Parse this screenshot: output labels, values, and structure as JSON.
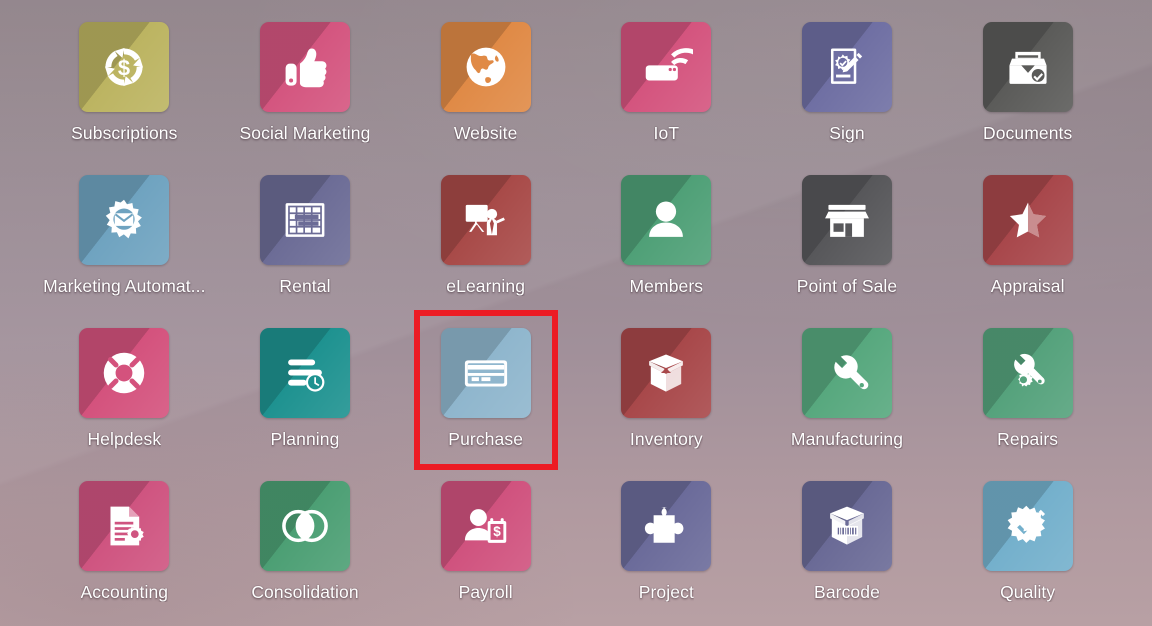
{
  "screen": {
    "title": "Odoo Apps Home Menu",
    "background_color": "#a08d93",
    "highlight_color": "#ec1c24",
    "label_color": "#ffffff"
  },
  "apps": [
    {
      "id": "subscriptions",
      "label": "Subscriptions",
      "icon": "refresh-dollar-icon",
      "tile_color": "#bcb461",
      "highlighted": false
    },
    {
      "id": "social-marketing",
      "label": "Social Marketing",
      "icon": "thumbs-up-icon",
      "tile_color": "#d4557f",
      "highlighted": false
    },
    {
      "id": "website",
      "label": "Website",
      "icon": "globe-icon",
      "tile_color": "#e08a46",
      "highlighted": false
    },
    {
      "id": "iot",
      "label": "IoT",
      "icon": "wifi-router-icon",
      "tile_color": "#d4547e",
      "highlighted": false
    },
    {
      "id": "sign",
      "label": "Sign",
      "icon": "document-pencil-icon",
      "tile_color": "#6f6fa3",
      "highlighted": false
    },
    {
      "id": "documents",
      "label": "Documents",
      "icon": "file-tray-check-icon",
      "tile_color": "#5b5b59",
      "highlighted": false
    },
    {
      "id": "marketing-automation",
      "label": "Marketing Automat...",
      "icon": "gear-envelope-icon",
      "tile_color": "#6fa3c0",
      "highlighted": false
    },
    {
      "id": "rental",
      "label": "Rental",
      "icon": "gantt-grid-icon",
      "tile_color": "#6c6c96",
      "highlighted": false
    },
    {
      "id": "elearning",
      "label": "eLearning",
      "icon": "presenter-board-icon",
      "tile_color": "#a84a48",
      "highlighted": false
    },
    {
      "id": "members",
      "label": "Members",
      "icon": "person-icon",
      "tile_color": "#4fa077",
      "highlighted": false
    },
    {
      "id": "point-of-sale",
      "label": "Point of Sale",
      "icon": "storefront-icon",
      "tile_color": "#57575a",
      "highlighted": false
    },
    {
      "id": "appraisal",
      "label": "Appraisal",
      "icon": "half-star-icon",
      "tile_color": "#a8474b",
      "highlighted": false
    },
    {
      "id": "helpdesk",
      "label": "Helpdesk",
      "icon": "lifebuoy-icon",
      "tile_color": "#d4527d",
      "highlighted": false
    },
    {
      "id": "planning",
      "label": "Planning",
      "icon": "bars-clock-icon",
      "tile_color": "#1e9290",
      "highlighted": false
    },
    {
      "id": "purchase",
      "label": "Purchase",
      "icon": "credit-card-icon",
      "tile_color": "#8fb6cd",
      "highlighted": true
    },
    {
      "id": "inventory",
      "label": "Inventory",
      "icon": "open-box-icon",
      "tile_color": "#a8484a",
      "highlighted": false
    },
    {
      "id": "manufacturing",
      "label": "Manufacturing",
      "icon": "wrench-icon",
      "tile_color": "#57a87e",
      "highlighted": false
    },
    {
      "id": "repairs",
      "label": "Repairs",
      "icon": "wrench-gear-icon",
      "tile_color": "#55a27c",
      "highlighted": false
    },
    {
      "id": "accounting",
      "label": "Accounting",
      "icon": "document-gear-icon",
      "tile_color": "#cf5480",
      "highlighted": false
    },
    {
      "id": "consolidation",
      "label": "Consolidation",
      "icon": "venn-circles-icon",
      "tile_color": "#4c9f74",
      "highlighted": false
    },
    {
      "id": "payroll",
      "label": "Payroll",
      "icon": "person-money-icon",
      "tile_color": "#d0527e",
      "highlighted": false
    },
    {
      "id": "project",
      "label": "Project",
      "icon": "puzzle-piece-icon",
      "tile_color": "#6b6b9a",
      "highlighted": false
    },
    {
      "id": "barcode",
      "label": "Barcode",
      "icon": "barcode-box-icon",
      "tile_color": "#6a6a96",
      "highlighted": false
    },
    {
      "id": "quality",
      "label": "Quality",
      "icon": "badge-pencil-icon",
      "tile_color": "#74b0cc",
      "highlighted": false
    }
  ]
}
